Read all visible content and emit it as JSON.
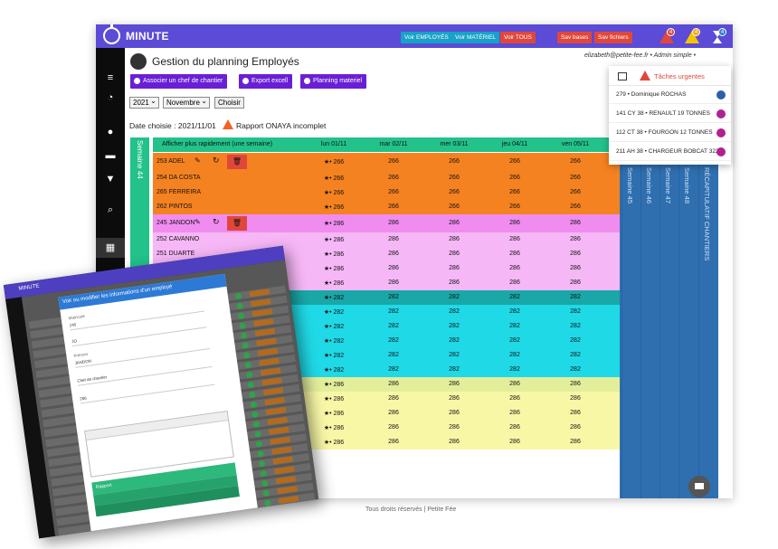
{
  "app": {
    "title": "MINUTE",
    "top_buttons": [
      {
        "label": "Voir EMPLOYÉS",
        "style": "teal"
      },
      {
        "label": "Voir MATÉRIEL",
        "style": "teal"
      },
      {
        "label": "Voir TOUS",
        "style": "red"
      },
      {
        "label": "Sav bases",
        "style": "red"
      },
      {
        "label": "Sav fichiers",
        "style": "red"
      }
    ],
    "notif_badges": [
      "4",
      "4",
      "4"
    ],
    "user_info": "elizabeth@petite-fee.fr • Admin simple • ",
    "page_title": "Gestion du planning Employés",
    "actions": [
      {
        "label": "Associer un chef de chantier"
      },
      {
        "label": "Export excell"
      },
      {
        "label": "Planning materiel"
      }
    ],
    "year": "2021",
    "month": "Novembre",
    "choose_button": "Choisir",
    "date_chosen": "Date choisie : 2021/11/01",
    "warning_text": "Rapport ONAYA incomplet",
    "week_label": "Semaine 44",
    "footer": "Tous droits réservés | Petite Fée"
  },
  "colors": {
    "header": "#5b4bd6",
    "accent_green": "#22c28a",
    "orange": "#f58220",
    "pink": "#f08cf0",
    "pink_light": "#f6b7f6",
    "teal": "#19a7a7",
    "cyan": "#1fd9e6",
    "olive": "#e3ee9b",
    "yellow": "#f8f7a6",
    "blue": "#2f6fb0"
  },
  "grid": {
    "header_text": "Afficher plus rapidement (une semaine)",
    "days": [
      "lun 01/11",
      "mar 02/11",
      "mer 03/11",
      "jeu 04/11",
      "ven 05/11"
    ],
    "rows": [
      {
        "name": "253 ADEL",
        "val": "266",
        "color": "#f58220",
        "tools": true
      },
      {
        "name": "254 DA COSTA",
        "val": "266",
        "color": "#f58220"
      },
      {
        "name": "265 FERREIRA",
        "val": "266",
        "color": "#f58220"
      },
      {
        "name": "262 PINTOS",
        "val": "266",
        "color": "#f58220"
      },
      {
        "name": "245 JANDON",
        "val": "286",
        "color": "#f08cf0",
        "tools": true
      },
      {
        "name": "252 CAVANNO",
        "val": "286",
        "color": "#f6b7f6"
      },
      {
        "name": "251 DUARTE",
        "val": "286",
        "color": "#f6b7f6"
      },
      {
        "name": "",
        "val": "286",
        "color": "#f6b7f6"
      },
      {
        "name": "",
        "val": "286",
        "color": "#f6b7f6"
      },
      {
        "name": "",
        "val": "282",
        "color": "#19a7a7"
      },
      {
        "name": "",
        "val": "282",
        "color": "#1fd9e6"
      },
      {
        "name": "",
        "val": "282",
        "color": "#1fd9e6"
      },
      {
        "name": "",
        "val": "282",
        "color": "#1fd9e6"
      },
      {
        "name": "",
        "val": "282",
        "color": "#1fd9e6"
      },
      {
        "name": "",
        "val": "282",
        "color": "#1fd9e6"
      },
      {
        "name": "",
        "val": "286",
        "color": "#e3ee9b"
      },
      {
        "name": "",
        "val": "286",
        "color": "#f8f7a6"
      },
      {
        "name": "",
        "val": "286",
        "color": "#f8f7a6"
      },
      {
        "name": "",
        "val": "286",
        "color": "#f8f7a6"
      },
      {
        "name": "",
        "val": "286",
        "color": "#f8f7a6"
      }
    ],
    "right_columns": [
      "Semaine 45",
      "Semaine 46",
      "Semaine 47",
      "Semaine 48",
      "RÉCAPITULATIF CHANTIERS"
    ]
  },
  "urgent": {
    "title": "Tâches urgentes",
    "items": [
      {
        "text": "279 • Dominique ROCHAS",
        "color": "#2d5fa8"
      },
      {
        "text": "141 CY 38 • RENAULT 19 TONNES",
        "color": "#b0228f"
      },
      {
        "text": "112 CT 38 • FOURGON 12 TONNES",
        "color": "#b0228f"
      },
      {
        "text": "211 AH 38 • CHARGEUR BOBCAT 322",
        "color": "#b0228f"
      }
    ]
  },
  "modal": {
    "app_title": "MINUTE",
    "title": "Voir ou modifier les informations d'un employé",
    "fields": [
      {
        "label": "Matricule",
        "value": "245"
      },
      {
        "label": "",
        "value": "JO"
      },
      {
        "label": "Prénom",
        "value": "JANDON"
      },
      {
        "label": "",
        "value": "Chef de chantier"
      },
      {
        "label": "",
        "value": "286"
      }
    ],
    "report_label": "Rapport"
  }
}
